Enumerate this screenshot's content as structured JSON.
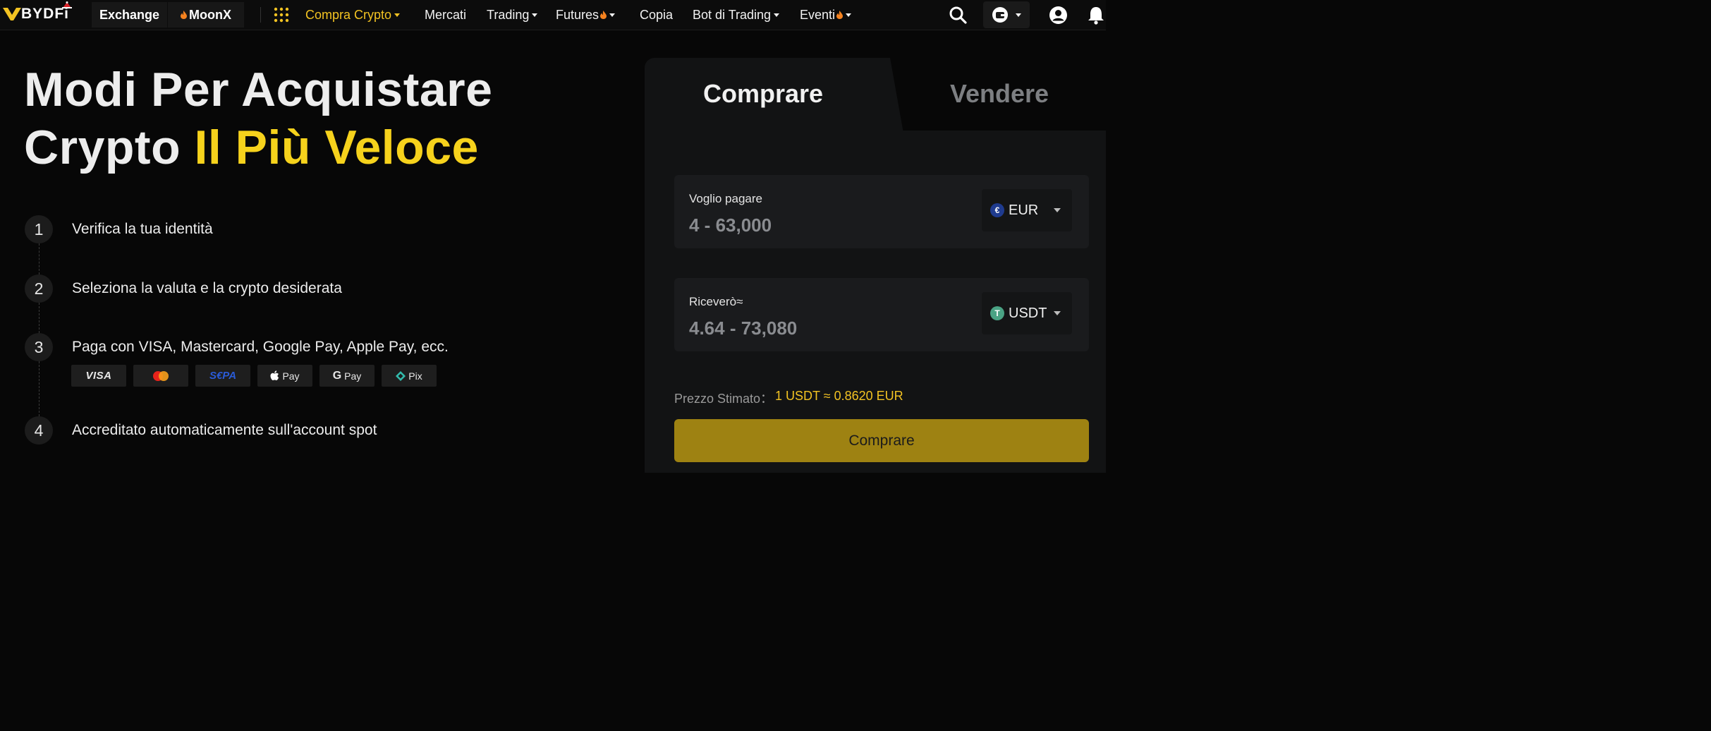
{
  "header": {
    "logo_text": "BYDFi",
    "pills": [
      "Exchange",
      "MoonX"
    ],
    "nav": [
      {
        "label": "Compra Crypto",
        "active": true,
        "caret": true,
        "flame": false
      },
      {
        "label": "Mercati",
        "active": false,
        "caret": false,
        "flame": false
      },
      {
        "label": "Trading",
        "active": false,
        "caret": true,
        "flame": false
      },
      {
        "label": "Futures",
        "active": false,
        "caret": true,
        "flame": true
      },
      {
        "label": "Copia",
        "active": false,
        "caret": false,
        "flame": false
      },
      {
        "label": "Bot di Trading",
        "active": false,
        "caret": true,
        "flame": false
      },
      {
        "label": "Eventi",
        "active": false,
        "caret": true,
        "flame": true
      }
    ],
    "icons": [
      "search-icon",
      "wallet-icon",
      "user-icon",
      "bell-icon"
    ]
  },
  "hero": {
    "line1": "Modi Per Acquistare",
    "line2_plain": "Crypto ",
    "line2_highlight": "Il Più Veloce"
  },
  "steps": [
    {
      "num": "1",
      "text": "Verifica la tua identità"
    },
    {
      "num": "2",
      "text": "Seleziona la valuta e la crypto desiderata"
    },
    {
      "num": "3",
      "text": "Paga con VISA, Mastercard, Google Pay, Apple Pay, ecc."
    },
    {
      "num": "4",
      "text": "Accreditato automaticamente sull'account spot"
    }
  ],
  "payment_methods": [
    {
      "name": "visa",
      "label": "VISA"
    },
    {
      "name": "mastercard",
      "label": ""
    },
    {
      "name": "sepa",
      "label": "S€PA"
    },
    {
      "name": "apple-pay",
      "label": "Pay"
    },
    {
      "name": "google-pay",
      "label": "Pay"
    },
    {
      "name": "pix",
      "label": "Pix"
    }
  ],
  "trade": {
    "tab_buy": "Comprare",
    "tab_sell": "Vendere",
    "pay": {
      "label": "Voglio pagare",
      "range": "4 - 63,000",
      "currency": "EUR",
      "currency_symbol": "€",
      "currency_color": "#1f3b8f"
    },
    "receive": {
      "label": "Riceverò≈",
      "range": "4.64 - 73,080",
      "currency": "USDT",
      "currency_symbol": "T",
      "currency_color": "#4aa384"
    },
    "price_label": "Prezzo Stimato：",
    "price_value": "1 USDT ≈ 0.8620 EUR",
    "button": "Comprare"
  },
  "colors": {
    "accent": "#f3c322",
    "highlight": "#f6d21c",
    "button": "#9e8212"
  }
}
